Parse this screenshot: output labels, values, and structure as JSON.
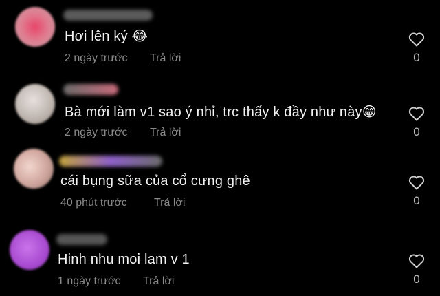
{
  "comments": [
    {
      "text": "Hơi lên ký 😂",
      "time": "2 ngày trước",
      "reply": "Trả lời",
      "likes": "0",
      "avatar_color": "#e05a7a"
    },
    {
      "text": "Bà mới làm v1 sao ý nhỉ, trc thấy k đầy như này😁",
      "time": "2 ngày trước",
      "reply": "Trả lời",
      "likes": "0",
      "avatar_color": "#cfc7c2"
    },
    {
      "text": "cái bụng sữa của cổ cưng ghê",
      "time": "40 phút trước",
      "reply": "Trả lời",
      "likes": "0",
      "avatar_color": "#d9b8b0"
    },
    {
      "text": "Hinh nhu moi lam v 1",
      "time": "1 ngày trước",
      "reply": "Trả lời",
      "likes": "0",
      "avatar_color": "#b34fd6"
    }
  ],
  "icons": {
    "like": "heart-outline-icon"
  }
}
